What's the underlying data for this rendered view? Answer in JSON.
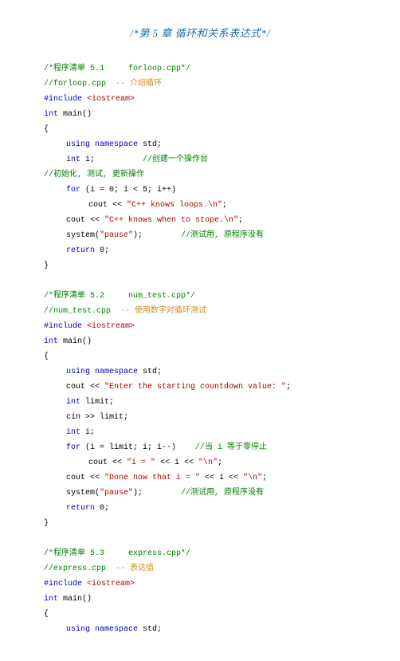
{
  "title": "/*第 5 章  循环和关系表达式*/",
  "blocks": [
    {
      "l1": {
        "c": "green",
        "t": "/*程序清单 5.1     forloop.cpp*/"
      },
      "l2a": {
        "c": "green",
        "t": "//forloop.cpp  "
      },
      "l2b": {
        "c": "orange",
        "t": "-- 介绍循环"
      },
      "l3a": {
        "c": "blue",
        "t": "#include "
      },
      "l3b": {
        "c": "dred",
        "t": "<iostream>"
      },
      "l4a": {
        "c": "blue",
        "t": "int "
      },
      "l4b": {
        "c": "black",
        "t": "main()"
      },
      "l5": {
        "c": "black",
        "t": "{"
      },
      "l6a": {
        "c": "blue",
        "t": "using namespace "
      },
      "l6b": {
        "c": "black",
        "t": "std;"
      },
      "l7a": {
        "c": "blue",
        "t": "int "
      },
      "l7b": {
        "c": "black",
        "t": "i;          "
      },
      "l7c": {
        "c": "green",
        "t": "//创建一个操作台"
      },
      "l8": {
        "c": "green",
        "t": "//初始化, 测试, 更新操作"
      },
      "l9a": {
        "c": "blue",
        "t": "for "
      },
      "l9b": {
        "c": "black",
        "t": "(i = 0; i < 5; i++)"
      },
      "l10a": {
        "c": "black",
        "t": "cout << "
      },
      "l10b": {
        "c": "dred",
        "t": "\"C++ knows loops.\\n\""
      },
      "l10c": {
        "c": "black",
        "t": ";"
      },
      "l11a": {
        "c": "black",
        "t": "cout << "
      },
      "l11b": {
        "c": "dred",
        "t": "\"C++ knows when to stope.\\n\""
      },
      "l11c": {
        "c": "black",
        "t": ";"
      },
      "l12a": {
        "c": "black",
        "t": "system("
      },
      "l12b": {
        "c": "dred",
        "t": "\"pause\""
      },
      "l12c": {
        "c": "black",
        "t": ");        "
      },
      "l12d": {
        "c": "green",
        "t": "//测试用, 原程序没有"
      },
      "l13a": {
        "c": "blue",
        "t": "return "
      },
      "l13b": {
        "c": "black",
        "t": "0;"
      },
      "l14": {
        "c": "black",
        "t": "}"
      }
    },
    {
      "l1": {
        "c": "green",
        "t": "/*程序清单 5.2     num_test.cpp*/"
      },
      "l2a": {
        "c": "green",
        "t": "//num_test.cpp  "
      },
      "l2b": {
        "c": "orange",
        "t": "-- 使用数字对循环测试"
      },
      "l3a": {
        "c": "blue",
        "t": "#include "
      },
      "l3b": {
        "c": "dred",
        "t": "<iostream>"
      },
      "l4a": {
        "c": "blue",
        "t": "int "
      },
      "l4b": {
        "c": "black",
        "t": "main()"
      },
      "l5": {
        "c": "black",
        "t": "{"
      },
      "l6a": {
        "c": "blue",
        "t": "using namespace "
      },
      "l6b": {
        "c": "black",
        "t": "std;"
      },
      "l7a": {
        "c": "black",
        "t": "cout << "
      },
      "l7b": {
        "c": "dred",
        "t": "\"Enter the starting countdown value: \""
      },
      "l7c": {
        "c": "black",
        "t": ";"
      },
      "l8a": {
        "c": "blue",
        "t": "int "
      },
      "l8b": {
        "c": "black",
        "t": "limit;"
      },
      "l9": {
        "c": "black",
        "t": "cin >> limit;"
      },
      "l10a": {
        "c": "blue",
        "t": "int "
      },
      "l10b": {
        "c": "black",
        "t": "i;"
      },
      "l11a": {
        "c": "blue",
        "t": "for "
      },
      "l11b": {
        "c": "black",
        "t": "(i = limit; i; i--)    "
      },
      "l11c": {
        "c": "green",
        "t": "//当 i 等于零停止"
      },
      "l12a": {
        "c": "black",
        "t": "cout << "
      },
      "l12b": {
        "c": "dred",
        "t": "\"i = \""
      },
      "l12c": {
        "c": "black",
        "t": " << i << "
      },
      "l12d": {
        "c": "dred",
        "t": "\"\\n\""
      },
      "l12e": {
        "c": "black",
        "t": ";"
      },
      "l13a": {
        "c": "black",
        "t": "cout << "
      },
      "l13b": {
        "c": "dred",
        "t": "\"Done now that i = \""
      },
      "l13c": {
        "c": "black",
        "t": " << i << "
      },
      "l13d": {
        "c": "dred",
        "t": "\"\\n\""
      },
      "l13e": {
        "c": "black",
        "t": ";"
      },
      "l14a": {
        "c": "black",
        "t": "system("
      },
      "l14b": {
        "c": "dred",
        "t": "\"pause\""
      },
      "l14c": {
        "c": "black",
        "t": ");        "
      },
      "l14d": {
        "c": "green",
        "t": "//测试用, 原程序没有"
      },
      "l15a": {
        "c": "blue",
        "t": "return "
      },
      "l15b": {
        "c": "black",
        "t": "0;"
      },
      "l16": {
        "c": "black",
        "t": "}"
      }
    },
    {
      "l1": {
        "c": "green",
        "t": "/*程序清单 5.3     express.cpp*/"
      },
      "l2a": {
        "c": "green",
        "t": "//express.cpp  "
      },
      "l2b": {
        "c": "orange",
        "t": "-- 表达值"
      },
      "l3a": {
        "c": "blue",
        "t": "#include "
      },
      "l3b": {
        "c": "dred",
        "t": "<iostream>"
      },
      "l4a": {
        "c": "blue",
        "t": "int "
      },
      "l4b": {
        "c": "black",
        "t": "main()"
      },
      "l5": {
        "c": "black",
        "t": "{"
      },
      "l6a": {
        "c": "blue",
        "t": "using namespace "
      },
      "l6b": {
        "c": "black",
        "t": "std;"
      }
    }
  ]
}
